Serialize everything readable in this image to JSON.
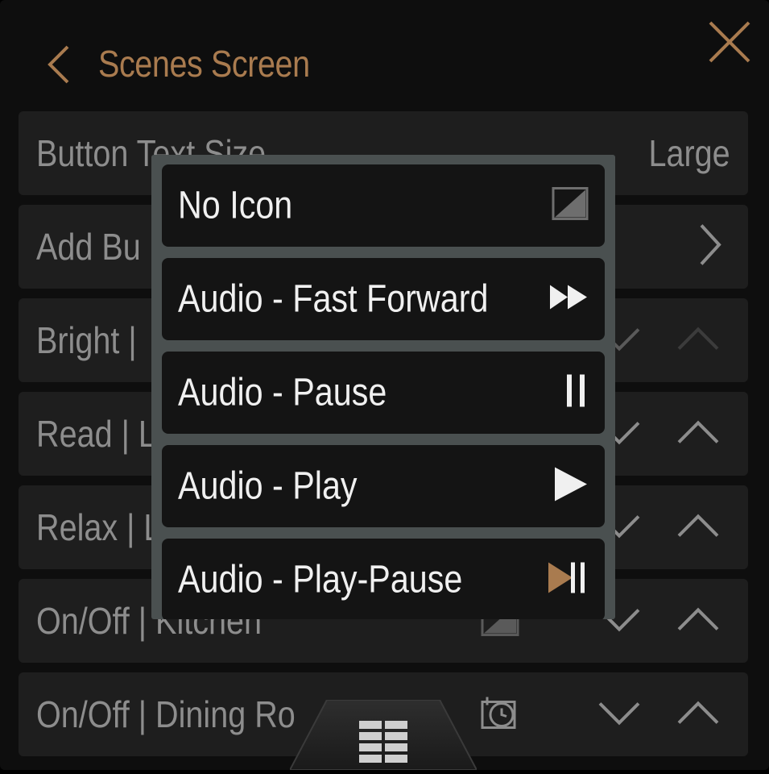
{
  "header": {
    "title": "Scenes Screen"
  },
  "settings": {
    "button_text_size_label": "Button Text Size",
    "button_text_size_value": "Large",
    "add_button_label": "Add Bu"
  },
  "scenes": [
    {
      "label": "Bright | "
    },
    {
      "label": "Read | L"
    },
    {
      "label": "Relax | L"
    },
    {
      "label": "On/Off | Kitchen"
    },
    {
      "label": "On/Off | Dining Ro"
    }
  ],
  "icon_picker": {
    "options": [
      {
        "label": "No Icon",
        "icon": "no-icon-placeholder"
      },
      {
        "label": "Audio - Fast Forward",
        "icon": "fast-forward-icon"
      },
      {
        "label": "Audio - Pause",
        "icon": "pause-icon"
      },
      {
        "label": "Audio - Play",
        "icon": "play-icon"
      },
      {
        "label": "Audio - Play-Pause",
        "icon": "play-pause-icon"
      }
    ]
  },
  "colors": {
    "accent": "#a97b4f",
    "row_bg": "#1e1e1e",
    "popup_border": "#4a5050",
    "option_bg": "#141414"
  }
}
